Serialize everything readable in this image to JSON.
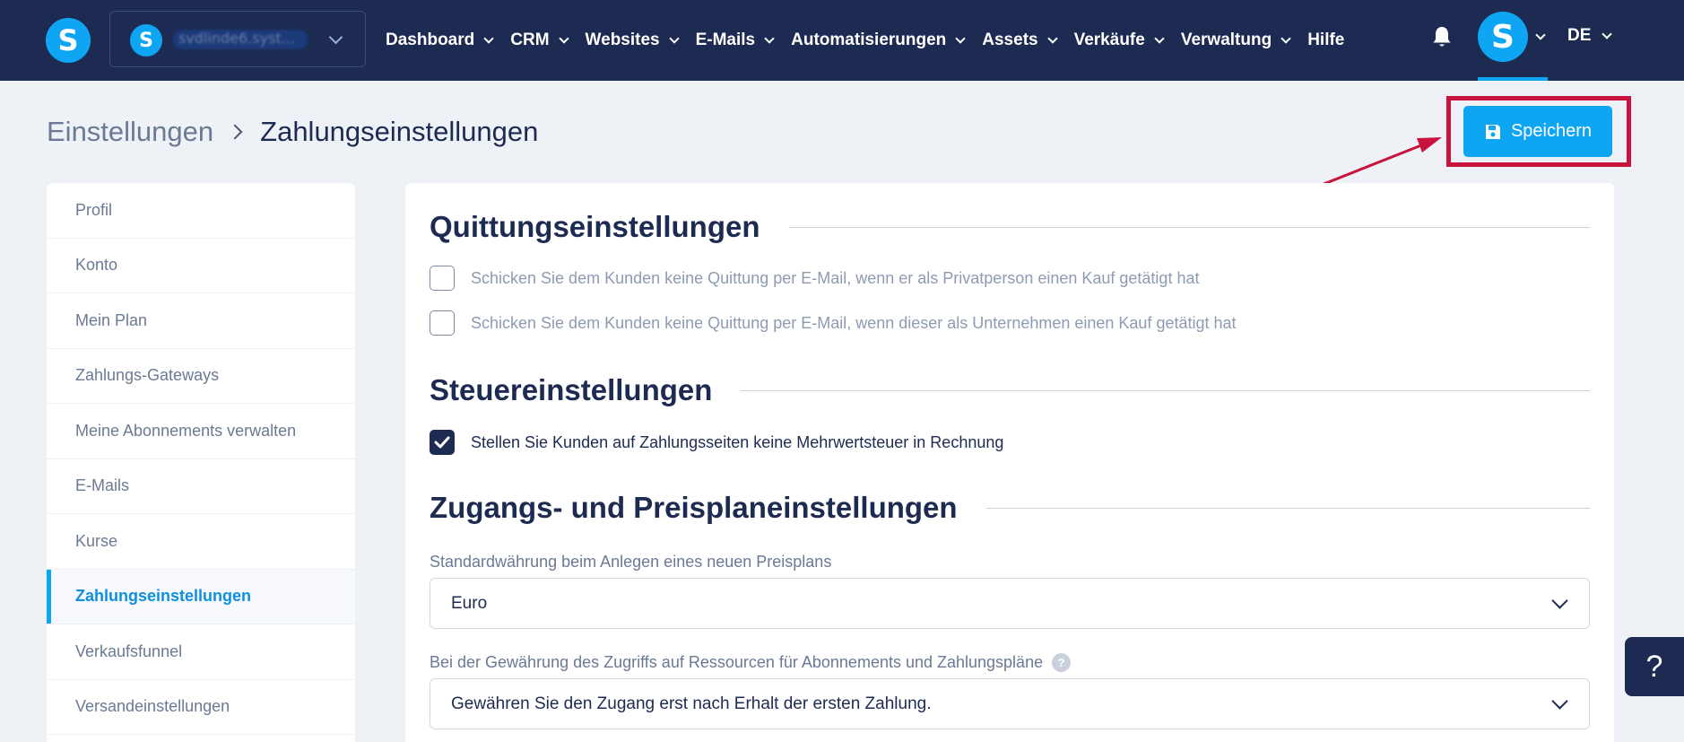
{
  "topbar": {
    "logo_letter": "S",
    "site_selector": {
      "logo_letter": "S",
      "name": "svdlinde6.syst..."
    },
    "nav": [
      {
        "label": "Dashboard",
        "has_dropdown": true
      },
      {
        "label": "CRM",
        "has_dropdown": true
      },
      {
        "label": "Websites",
        "has_dropdown": true
      },
      {
        "label": "E-Mails",
        "has_dropdown": true
      },
      {
        "label": "Automatisierungen",
        "has_dropdown": true
      },
      {
        "label": "Assets",
        "has_dropdown": true
      },
      {
        "label": "Verkäufe",
        "has_dropdown": true
      },
      {
        "label": "Verwaltung",
        "has_dropdown": true
      },
      {
        "label": "Hilfe",
        "has_dropdown": false
      }
    ],
    "avatar_letter": "S",
    "language": "DE"
  },
  "breadcrumb": {
    "parent": "Einstellungen",
    "current": "Zahlungseinstellungen"
  },
  "toolbar": {
    "save_label": "Speichern"
  },
  "sidebar": {
    "items": [
      {
        "label": "Profil",
        "active": false
      },
      {
        "label": "Konto",
        "active": false
      },
      {
        "label": "Mein Plan",
        "active": false
      },
      {
        "label": "Zahlungs-Gateways",
        "active": false
      },
      {
        "label": "Meine Abonnements verwalten",
        "active": false
      },
      {
        "label": "E-Mails",
        "active": false
      },
      {
        "label": "Kurse",
        "active": false
      },
      {
        "label": "Zahlungseinstellungen",
        "active": true
      },
      {
        "label": "Verkaufsfunnel",
        "active": false
      },
      {
        "label": "Versandeinstellungen",
        "active": false
      }
    ]
  },
  "main": {
    "receipts": {
      "title": "Quittungseinstellungen",
      "options": [
        {
          "label": "Schicken Sie dem Kunden keine Quittung per E-Mail, wenn er als Privatperson einen Kauf getätigt hat",
          "checked": false
        },
        {
          "label": "Schicken Sie dem Kunden keine Quittung per E-Mail, wenn dieser als Unternehmen einen Kauf getätigt hat",
          "checked": false
        }
      ]
    },
    "tax": {
      "title": "Steuereinstellungen",
      "options": [
        {
          "label": "Stellen Sie Kunden auf Zahlungsseiten keine Mehrwertsteuer in Rechnung",
          "checked": true
        }
      ]
    },
    "access": {
      "title": "Zugangs- und Preisplaneinstellungen",
      "currency_label": "Standardwährung beim Anlegen eines neuen Preisplans",
      "currency_value": "Euro",
      "grant_label": "Bei der Gewährung des Zugriffs auf Ressourcen für Abonnements und Zahlungspläne",
      "grant_help": "?",
      "grant_value": "Gewähren Sie den Zugang erst nach Erhalt der ersten Zahlung."
    }
  },
  "help_button": "?",
  "colors": {
    "nav_bg": "#1d2b53",
    "accent": "#0ea5f3",
    "highlight": "#c8143c"
  }
}
